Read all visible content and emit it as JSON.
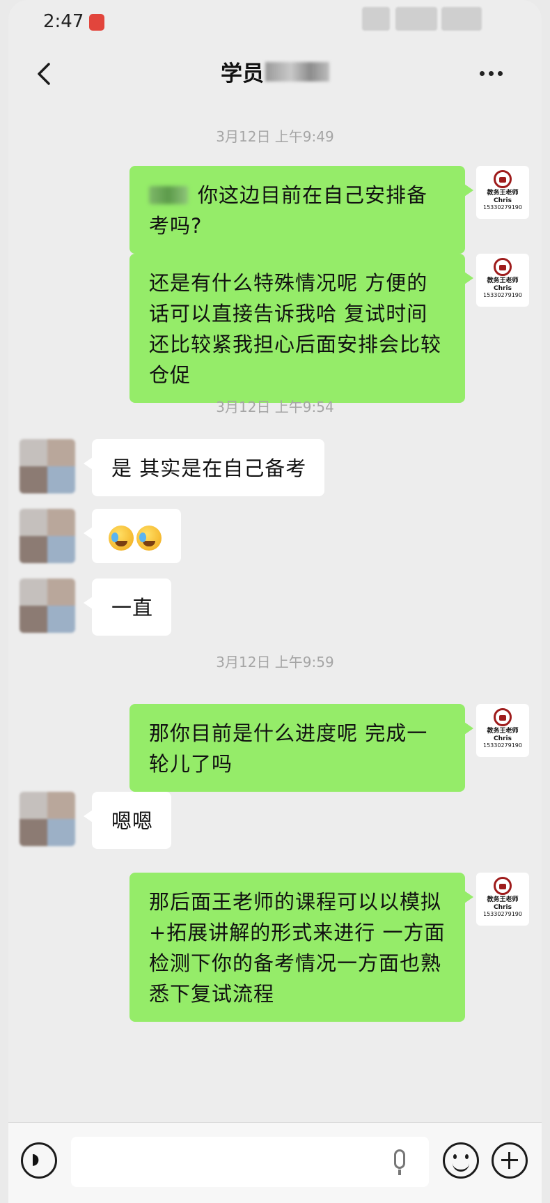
{
  "status_bar": {
    "time": "2:47"
  },
  "header": {
    "title": "学员"
  },
  "teacher_avatar": {
    "title": "教务王老师",
    "name": "Chris",
    "phone": "15330279190"
  },
  "messages": [
    {
      "type": "timestamp",
      "text": "3月12日 上午9:49"
    },
    {
      "type": "outgoing",
      "text": "你这边目前在自己安排备考吗?"
    },
    {
      "type": "outgoing",
      "text": "还是有什么特殊情况呢  方便的话可以直接告诉我哈  复试时间还比较紧我担心后面安排会比较仓促"
    },
    {
      "type": "timestamp",
      "text": "3月12日 上午9:54"
    },
    {
      "type": "incoming",
      "text": "是 其实是在自己备考"
    },
    {
      "type": "incoming",
      "text": "",
      "emoji": [
        "loudly-crying-emoji",
        "loudly-crying-emoji"
      ]
    },
    {
      "type": "incoming",
      "text": "一直"
    },
    {
      "type": "timestamp",
      "text": "3月12日 上午9:59"
    },
    {
      "type": "outgoing",
      "text": "那你目前是什么进度呢  完成一轮儿了吗"
    },
    {
      "type": "incoming",
      "text": "嗯嗯"
    },
    {
      "type": "outgoing",
      "text": "那后面王老师的课程可以以模拟+拓展讲解的形式来进行  一方面检测下你的备考情况一方面也熟悉下复试流程"
    }
  ],
  "input_bar": {
    "placeholder": ""
  }
}
